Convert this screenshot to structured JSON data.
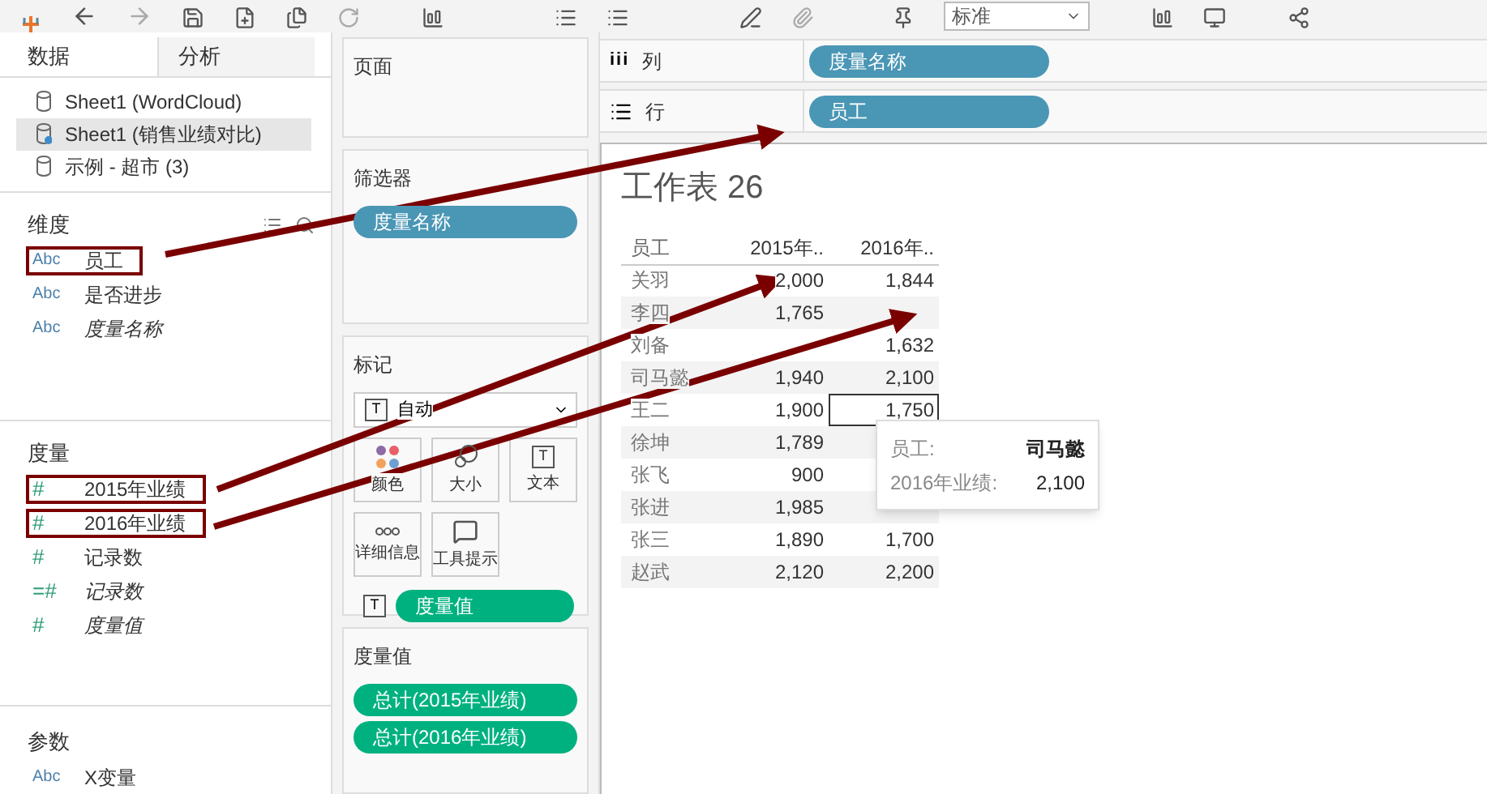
{
  "toolbar": {
    "dropdown": "标准"
  },
  "data_pane": {
    "tabs": [
      {
        "label": "数据",
        "selected": true
      },
      {
        "label": "分析",
        "selected": false
      }
    ],
    "sources": [
      {
        "label": "Sheet1 (WordCloud)",
        "selected": false,
        "linked": false
      },
      {
        "label": "Sheet1 (销售业绩对比)",
        "selected": true,
        "linked": true
      },
      {
        "label": "示例 - 超市 (3)",
        "selected": false,
        "linked": false
      }
    ],
    "dimensions": {
      "title": "维度",
      "items": [
        {
          "type": "Abc",
          "label": "员工",
          "italic": false,
          "highlighted": true
        },
        {
          "type": "Abc",
          "label": "是否进步",
          "italic": false,
          "highlighted": false
        },
        {
          "type": "Abc",
          "label": "度量名称",
          "italic": true,
          "highlighted": false
        }
      ]
    },
    "measures": {
      "title": "度量",
      "items": [
        {
          "type": "#",
          "label": "2015年业绩",
          "italic": false,
          "highlighted": true
        },
        {
          "type": "#",
          "label": "2016年业绩",
          "italic": false,
          "highlighted": true
        },
        {
          "type": "#",
          "label": "记录数",
          "italic": false,
          "highlighted": false
        },
        {
          "type": "=#",
          "label": "记录数",
          "italic": true,
          "highlighted": false
        },
        {
          "type": "#",
          "label": "度量值",
          "italic": true,
          "highlighted": false
        }
      ]
    },
    "parameters": {
      "title": "参数",
      "items": [
        {
          "type": "Abc",
          "label": "X变量",
          "italic": false,
          "highlighted": false
        }
      ]
    }
  },
  "cards": {
    "pages": {
      "title": "页面"
    },
    "filters": {
      "title": "筛选器",
      "pills": [
        "度量名称"
      ]
    },
    "marks": {
      "title": "标记",
      "mark_type_icon": "T",
      "mark_type": "自动",
      "buttons": [
        {
          "kind": "color",
          "label": "颜色"
        },
        {
          "kind": "size",
          "label": "大小"
        },
        {
          "kind": "text",
          "label": "文本",
          "icon": "T"
        },
        {
          "kind": "detail",
          "label": "详细信息"
        },
        {
          "kind": "tooltip",
          "label": "工具提示"
        }
      ],
      "text_pill_icon": "T",
      "text_pill": "度量值"
    },
    "measure_values": {
      "title": "度量值",
      "pills": [
        "总计(2015年业绩)",
        "总计(2016年业绩)"
      ]
    }
  },
  "shelves": [
    {
      "kind": "columns",
      "icon": "iii",
      "label": "列",
      "pills": [
        "度量名称"
      ]
    },
    {
      "kind": "rows",
      "label": "行",
      "pills": [
        "员工"
      ]
    }
  ],
  "sheet": {
    "title": "工作表 26",
    "columns": [
      "员工",
      "2015年..",
      "2016年.."
    ],
    "rows": [
      {
        "cells": [
          "关羽",
          "2,000",
          "1,844"
        ],
        "selected": false
      },
      {
        "cells": [
          "李四",
          "1,765",
          ""
        ],
        "selected": false
      },
      {
        "cells": [
          "刘备",
          "",
          "1,632"
        ],
        "selected": false
      },
      {
        "cells": [
          "司马懿",
          "1,940",
          "2,100"
        ],
        "selected": false
      },
      {
        "cells": [
          "王二",
          "1,900",
          "1,750"
        ],
        "selected": true
      },
      {
        "cells": [
          "徐坤",
          "1,789",
          ""
        ],
        "selected": false
      },
      {
        "cells": [
          "张飞",
          "900",
          ""
        ],
        "selected": false
      },
      {
        "cells": [
          "张进",
          "1,985",
          ""
        ],
        "selected": false
      },
      {
        "cells": [
          "张三",
          "1,890",
          "1,700"
        ],
        "selected": false
      },
      {
        "cells": [
          "赵武",
          "2,120",
          "2,200"
        ],
        "selected": false
      }
    ]
  },
  "tooltip": {
    "lines": [
      {
        "label": "员工:",
        "value": "司马懿",
        "bold": true
      },
      {
        "label": "2016年业绩:",
        "value": "2,100",
        "bold": false
      }
    ]
  }
}
